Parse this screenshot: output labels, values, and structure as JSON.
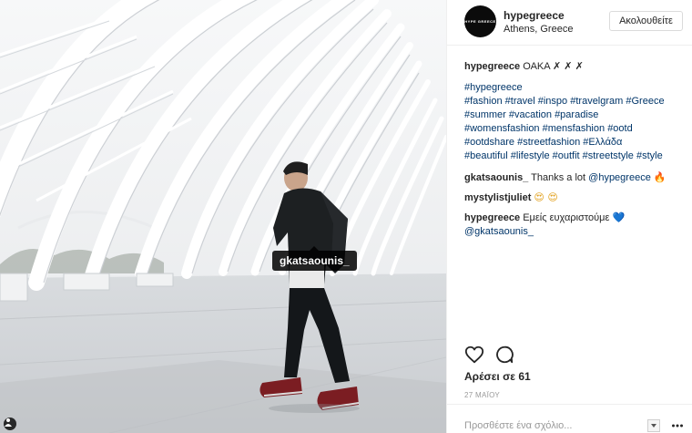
{
  "post": {
    "username": "hypegreece",
    "location": "Athens, Greece",
    "avatar_text": "HYPE GREECE",
    "follow_label": "Ακολουθείτε",
    "tagged_user": "gkatsaounis_"
  },
  "caption": {
    "username": "hypegreece",
    "text": "ΟΑΚΑ ✗ ✗ ✗",
    "hashtags": [
      "#hypegreece",
      "#fashion",
      "#travel",
      "#inspo",
      "#travelgram",
      "#Greece",
      "#summer",
      "#vacation",
      "#paradise",
      "#womensfashion",
      "#mensfashion",
      "#ootd",
      "#ootdshare",
      "#streetfashion",
      "#Ελλάδα",
      "#beautiful",
      "#lifestyle",
      "#outfit",
      "#streetstyle",
      "#style"
    ]
  },
  "comments": [
    {
      "username": "gkatsaounis_",
      "text": "Thanks a lot",
      "mention": "@hypegreece",
      "emoji": "🔥"
    },
    {
      "username": "mystylistjuliet",
      "text": "",
      "emoji": "😍 😍"
    },
    {
      "username": "hypegreece",
      "text": "Εμείς ευχαριστούμε",
      "emoji": "💙",
      "mention": "@gkatsaounis_"
    }
  ],
  "footer": {
    "likes": "Αρέσει σε 61",
    "date": "27 ΜΑΪΟΥ",
    "comment_placeholder": "Προσθέστε ένα σχόλιο..."
  },
  "icons": {
    "like": "heart-outline-icon",
    "comment": "speech-bubble-icon",
    "tagged": "person-icon",
    "more": "more-options-icon"
  },
  "colors": {
    "link": "#003569",
    "text": "#262626",
    "muted": "#999999",
    "border": "#efefef"
  }
}
